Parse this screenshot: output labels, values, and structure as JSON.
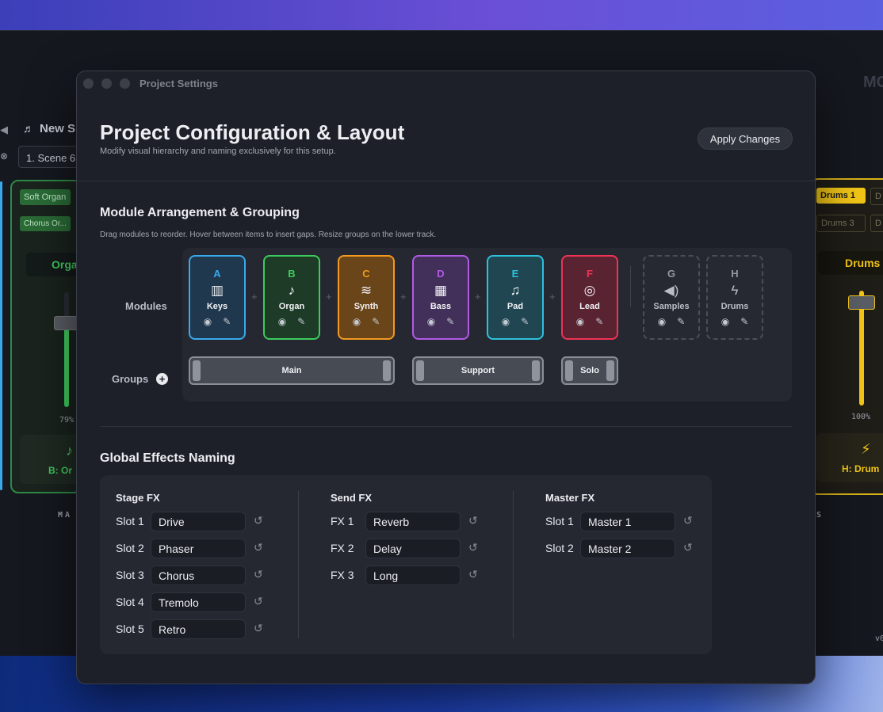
{
  "background_app": {
    "header_title": "New S",
    "scene": "1. Scene 6",
    "chips_left": [
      "Soft Organ",
      "Chorus Or..."
    ],
    "channel_left": "Orga",
    "percent_left": "79%",
    "channel_left_bottom": "B: Or",
    "section_left": "MA",
    "chips_right": [
      "Drums 1",
      "D",
      "Drums 3",
      "D"
    ],
    "channel_right": "Drums",
    "percent_right": "100%",
    "channel_right_bottom": "H: Drum",
    "section_right": "S",
    "corner_text": "MC",
    "version": "v0"
  },
  "window": {
    "title": "Project Settings",
    "heading": "Project Configuration & Layout",
    "subtitle": "Modify visual hierarchy and naming exclusively for this setup.",
    "apply_label": "Apply Changes"
  },
  "arrangement": {
    "title": "Module Arrangement & Grouping",
    "description": "Drag modules to reorder. Hover between items to insert gaps. Resize groups on the lower track.",
    "modules_label": "Modules",
    "groups_label": "Groups",
    "modules": [
      {
        "letter": "A",
        "name": "Keys",
        "icon": "piano-keys-icon",
        "color": "#3aa9ec",
        "bg": "#20384e"
      },
      {
        "letter": "B",
        "name": "Organ",
        "icon": "music-note-icon",
        "color": "#3ecb5d",
        "bg": "#1d3b27"
      },
      {
        "letter": "C",
        "name": "Synth",
        "icon": "waveform-icon",
        "color": "#f39a1e",
        "bg": "#6a4519"
      },
      {
        "letter": "D",
        "name": "Bass",
        "icon": "grid-icon",
        "color": "#b05ae6",
        "bg": "#43305a"
      },
      {
        "letter": "E",
        "name": "Pad",
        "icon": "guitar-icon",
        "color": "#2ec1de",
        "bg": "#1f4651"
      },
      {
        "letter": "F",
        "name": "Lead",
        "icon": "dial-icon",
        "color": "#ee3355",
        "bg": "#5a2332"
      },
      {
        "letter": "G",
        "name": "Samples",
        "icon": "speaker-icon"
      },
      {
        "letter": "H",
        "name": "Drums",
        "icon": "lightning-icon"
      }
    ],
    "groups": [
      "Main",
      "Support",
      "Solo"
    ]
  },
  "effects": {
    "title": "Global Effects Naming",
    "stage": {
      "title": "Stage FX",
      "slots": [
        {
          "label": "Slot 1",
          "value": "Drive"
        },
        {
          "label": "Slot 2",
          "value": "Phaser"
        },
        {
          "label": "Slot 3",
          "value": "Chorus"
        },
        {
          "label": "Slot 4",
          "value": "Tremolo"
        },
        {
          "label": "Slot 5",
          "value": "Retro"
        }
      ]
    },
    "send": {
      "title": "Send FX",
      "slots": [
        {
          "label": "FX 1",
          "value": "Reverb"
        },
        {
          "label": "FX 2",
          "value": "Delay"
        },
        {
          "label": "FX 3",
          "value": "Long"
        }
      ]
    },
    "master": {
      "title": "Master FX",
      "slots": [
        {
          "label": "Slot 1",
          "value": "Master 1"
        },
        {
          "label": "Slot 2",
          "value": "Master 2"
        }
      ]
    }
  }
}
